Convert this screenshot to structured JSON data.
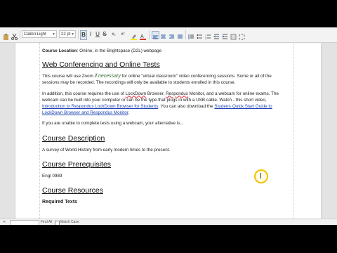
{
  "toolbar": {
    "font_name": "Calibri Light",
    "font_size": "22 pt",
    "bold_label": "B",
    "italic_label": "I",
    "underline_label": "U",
    "strike_label": "S",
    "subscript_label": "x₂",
    "superscript_label": "x²",
    "highlight_color": "#f4e600",
    "font_color": "#d9342b"
  },
  "document": {
    "location_label": "Course Location",
    "location_text": ": Online, in the Brightspace (D2L) webpage",
    "h_web": "Web Conferencing and Online Tests",
    "p1_a": "This course will use Zoom ",
    "p1_em": "if necessary",
    "p1_b": " for online \"virtual classroom\" video conferencing sessions. Some or all of the sessions may be recorded. The recordings will only be available to students enrolled in this course.",
    "p2_a": "In addition, this course requires the use of ",
    "p2_lockdown": "LockDown",
    "p2_b": " Browser, ",
    "p2_respondus": "Respondus",
    "p2_c": " Monitor, and a webcam for online exams. The webcam can be built into your computer or can be the type that plugs in with a USB cable. Watch - this short video, ",
    "p2_link1": "Introduction to Respondus LockDown Browser for Students",
    "p2_d": ". You can also download the ",
    "p2_link2": "Student- Quick Start Guide to LockDown Browser and Respondus Monitor",
    "p2_e": ".",
    "p3": "If you are unable to complete tests using a webcam, your alternative is...",
    "h_desc": "Course Description",
    "desc": "A survey of World History from early modern times to the present.",
    "h_prereq": "Course Prerequisites",
    "prereq": "Engl 0989",
    "h_resources": "Course Resources",
    "partial": "Required Texts"
  },
  "status": {
    "find_label": "Find All",
    "match_case": "Match Case"
  }
}
